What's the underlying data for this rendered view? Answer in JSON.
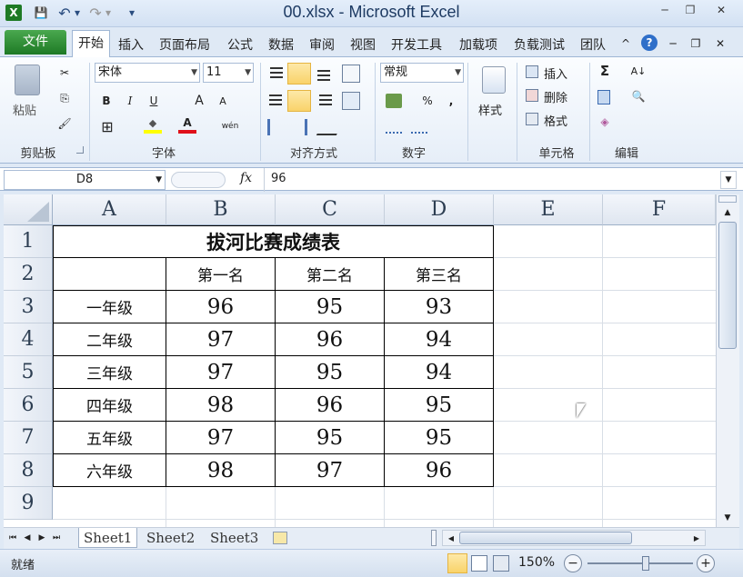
{
  "window": {
    "title": "00.xlsx - Microsoft Excel",
    "app_icon": "X",
    "qat": {
      "save_icon": "💾",
      "undo_icon": "↶",
      "redo_icon": "↷",
      "dropdown_icon": "▾"
    },
    "controls": {
      "minimize": "─",
      "restore": "❐",
      "close": "✕"
    }
  },
  "ribbon_tabs": {
    "file": "文件",
    "items": [
      "开始",
      "插入",
      "页面布局",
      "公式",
      "数据",
      "审阅",
      "视图",
      "开发工具",
      "加载项",
      "负载测试",
      "团队"
    ],
    "right_icons": {
      "collapse": "^",
      "help": "?",
      "min": "─",
      "restore": "❐",
      "close": "✕"
    }
  },
  "ribbon": {
    "clipboard": {
      "label": "剪贴板",
      "paste": "粘贴",
      "cut_icon": "✂",
      "copy_icon": "⎘",
      "painter_icon": "🖌"
    },
    "font": {
      "label": "字体",
      "name": "宋体",
      "size": "11",
      "bold": "B",
      "italic": "I",
      "underline": "U",
      "grow": "A",
      "shrink": "A",
      "border_icon": "⊞",
      "fill_icon": "◆",
      "color": "A",
      "phonetic": "wén"
    },
    "alignment": {
      "label": "对齐方式"
    },
    "number": {
      "label": "数字",
      "format": "常规",
      "percent": "%",
      "comma": ","
    },
    "styles": {
      "label": "样式"
    },
    "cells": {
      "label": "单元格",
      "insert": "插入",
      "delete": "删除",
      "format": "格式"
    },
    "editing": {
      "label": "编辑",
      "sum": "Σ",
      "sort": "A↓",
      "find": "🔍",
      "clear": "◈"
    }
  },
  "formula_bar": {
    "name_box": "D8",
    "fx": "fx",
    "value": "96"
  },
  "columns": [
    "A",
    "B",
    "C",
    "D",
    "E",
    "F"
  ],
  "rows": [
    "1",
    "2",
    "3",
    "4",
    "5",
    "6",
    "7",
    "8",
    "9"
  ],
  "table": {
    "title": "拔河比赛成绩表",
    "headers": [
      "第一名",
      "第二名",
      "第三名"
    ],
    "data": [
      {
        "grade": "一年级",
        "v": [
          "96",
          "95",
          "93"
        ]
      },
      {
        "grade": "二年级",
        "v": [
          "97",
          "96",
          "94"
        ]
      },
      {
        "grade": "三年级",
        "v": [
          "97",
          "95",
          "94"
        ]
      },
      {
        "grade": "四年级",
        "v": [
          "98",
          "96",
          "95"
        ]
      },
      {
        "grade": "五年级",
        "v": [
          "97",
          "95",
          "95"
        ]
      },
      {
        "grade": "六年级",
        "v": [
          "98",
          "97",
          "96"
        ]
      }
    ]
  },
  "sheets": [
    "Sheet1",
    "Sheet2",
    "Sheet3"
  ],
  "status": {
    "ready": "就绪",
    "zoom": "150%"
  }
}
